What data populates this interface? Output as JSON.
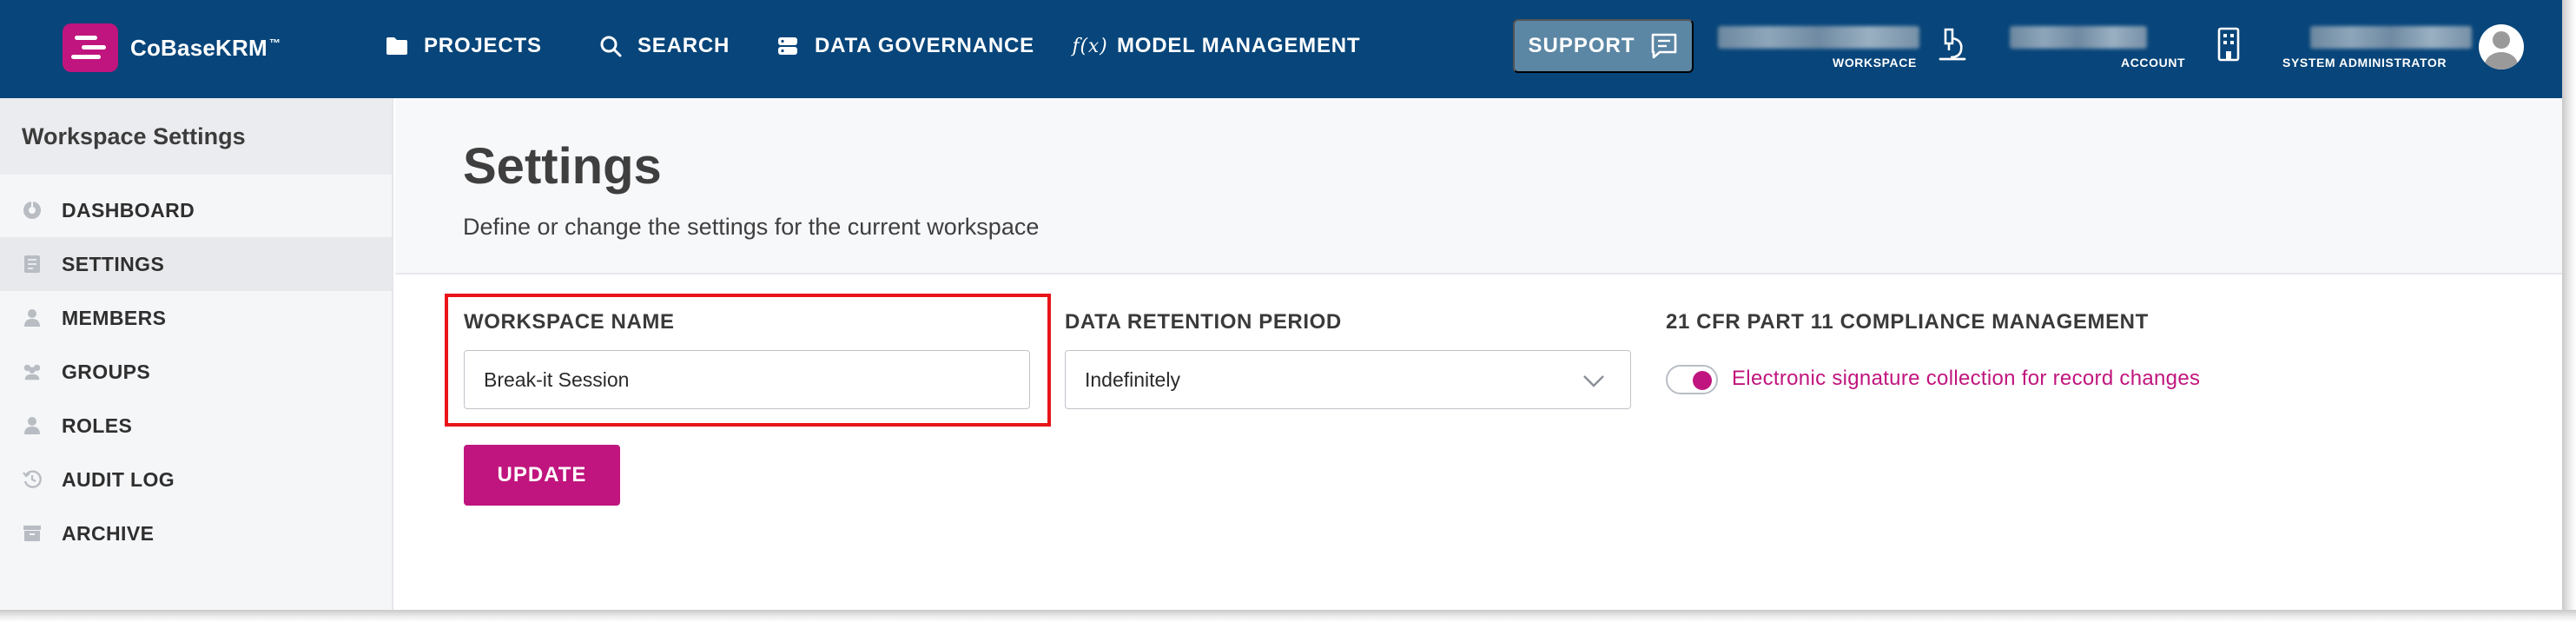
{
  "app": {
    "name": "CoBaseKRM",
    "trademark": "™"
  },
  "nav": {
    "items": [
      {
        "label": "PROJECTS",
        "icon": "folder-icon"
      },
      {
        "label": "SEARCH",
        "icon": "search-icon"
      },
      {
        "label": "DATA GOVERNANCE",
        "icon": "database-icon"
      },
      {
        "label": "MODEL MANAGEMENT",
        "icon": "function-icon",
        "icon_glyph": "f(x)"
      }
    ],
    "support_label": "SUPPORT",
    "workspace_caption": "WORKSPACE",
    "account_caption": "ACCOUNT",
    "user_caption": "SYSTEM ADMINISTRATOR"
  },
  "sidebar": {
    "title": "Workspace Settings",
    "items": [
      {
        "label": "DASHBOARD",
        "icon": "dashboard-icon",
        "active": false
      },
      {
        "label": "SETTINGS",
        "icon": "settings-icon",
        "active": true
      },
      {
        "label": "MEMBERS",
        "icon": "user-icon",
        "active": false
      },
      {
        "label": "GROUPS",
        "icon": "group-icon",
        "active": false
      },
      {
        "label": "ROLES",
        "icon": "role-icon",
        "active": false
      },
      {
        "label": "AUDIT LOG",
        "icon": "history-icon",
        "active": false
      },
      {
        "label": "ARCHIVE",
        "icon": "archive-icon",
        "active": false
      }
    ]
  },
  "main": {
    "title": "Settings",
    "description": "Define or change the settings for the current workspace",
    "workspace_name": {
      "label": "WORKSPACE NAME",
      "value": "Break-it Session"
    },
    "retention": {
      "label": "DATA RETENTION PERIOD",
      "selected": "Indefinitely"
    },
    "compliance": {
      "label": "21 CFR PART 11 COMPLIANCE MANAGEMENT",
      "toggle_label": "Electronic signature collection for record changes",
      "enabled": true
    },
    "update_label": "UPDATE"
  },
  "colors": {
    "topbar": "#07457a",
    "accent": "#c0157e",
    "support_button": "#5b86a4",
    "highlight": "#e8141a"
  }
}
